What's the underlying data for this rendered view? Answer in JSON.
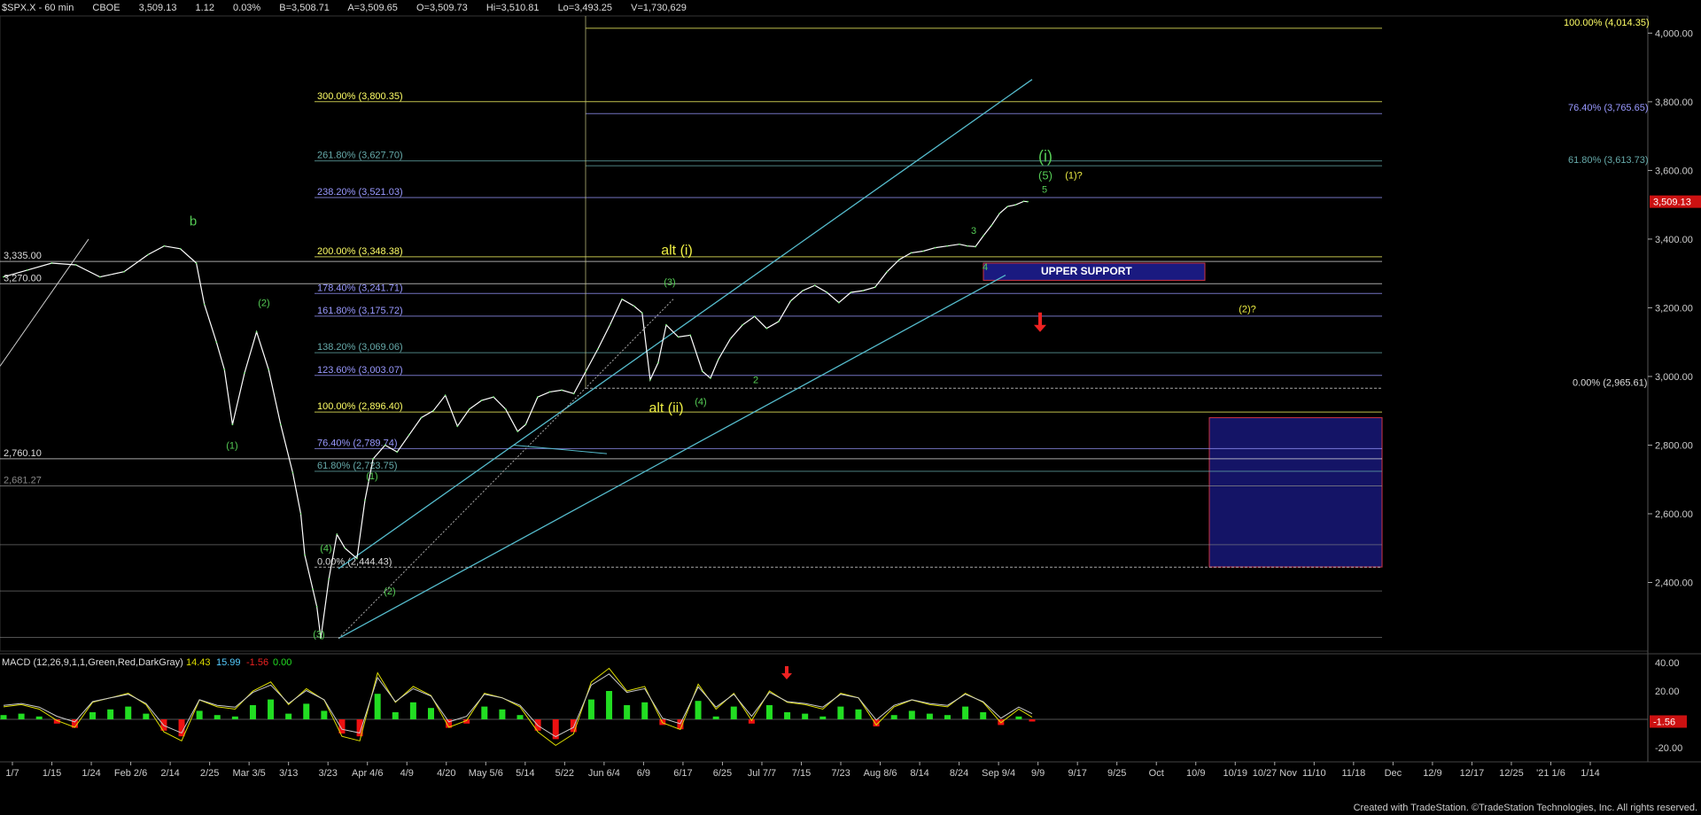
{
  "header": {
    "symbol": "$SPX.X - 60 min",
    "exchange": "CBOE",
    "last": "3,509.13",
    "change": "1.12",
    "change_pct": "0.03%",
    "bid": "B=3,508.71",
    "ask": "A=3,509.65",
    "open": "O=3,509.73",
    "high": "Hi=3,510.81",
    "low": "Lo=3,493.25",
    "volume": "V=1,730,629"
  },
  "macd_label": {
    "params": "MACD (12,26,9,1,1,Green,Red,DarkGray)",
    "v1": "14.43",
    "v2": "15.99",
    "v3": "-1.56",
    "v4": "0.00"
  },
  "credit": "Created with TradeStation. ©TradeStation Technologies, Inc. All rights reserved.",
  "colors": {
    "background": "#000000",
    "price": "#ffffff",
    "fib_yellow": "#ffff66",
    "fib_blue": "#9999ff",
    "fib_teal": "#66aaaa",
    "wave_green": "#55cc55",
    "alt_yellow": "#eeee44",
    "channel": "#55bbcc",
    "box_fill": "#141466",
    "box_border": "#cc3344",
    "macd_pos": "#22dd22",
    "macd_neg": "#ee1111",
    "price_tag": "#cc1111"
  },
  "chart_data": {
    "type": "line",
    "title": "$SPX.X - 60 min",
    "ylim": [
      2200,
      4050
    ],
    "y_ticks": [
      "4,000.00",
      "3,800.00",
      "3,600.00",
      "3,400.00",
      "3,200.00",
      "3,000.00",
      "2,800.00",
      "2,600.00",
      "2,400.00"
    ],
    "y_tick_values": [
      4000,
      3800,
      3600,
      3400,
      3200,
      3000,
      2800,
      2600,
      2400
    ],
    "x_ticks": [
      "1/7",
      "1/15",
      "1/24",
      "Feb 2/6",
      "2/14",
      "2/25",
      "Mar 3/5",
      "3/13",
      "3/23",
      "Apr 4/6",
      "4/9",
      "4/20",
      "May 5/6",
      "5/14",
      "5/22",
      "Jun 6/4",
      "6/9",
      "6/17",
      "6/25",
      "Jul 7/7",
      "7/15",
      "7/23",
      "Aug 8/6",
      "8/14",
      "8/24",
      "Sep 9/4",
      "9/9",
      "9/17",
      "9/25",
      "Oct",
      "10/9",
      "10/19",
      "10/27 Nov",
      "11/10",
      "11/18",
      "Dec",
      "12/9",
      "12/17",
      "12/25",
      "'21 1/6",
      "1/14"
    ],
    "last_price": "3,509.13",
    "last_price_value": 3509.13,
    "price_path": [
      [
        0,
        3290
      ],
      [
        6,
        3310
      ],
      [
        12,
        3330
      ],
      [
        18,
        3325
      ],
      [
        24,
        3290
      ],
      [
        30,
        3305
      ],
      [
        36,
        3355
      ],
      [
        40,
        3380
      ],
      [
        44,
        3372
      ],
      [
        48,
        3330
      ],
      [
        50,
        3210
      ],
      [
        53,
        3100
      ],
      [
        55,
        3020
      ],
      [
        57,
        2860
      ],
      [
        60,
        3010
      ],
      [
        63,
        3130
      ],
      [
        66,
        3020
      ],
      [
        69,
        2860
      ],
      [
        72,
        2720
      ],
      [
        74,
        2600
      ],
      [
        75,
        2480
      ],
      [
        77,
        2380
      ],
      [
        78,
        2330
      ],
      [
        79,
        2237
      ],
      [
        81,
        2410
      ],
      [
        83,
        2540
      ],
      [
        85,
        2500
      ],
      [
        88,
        2470
      ],
      [
        90,
        2640
      ],
      [
        92,
        2760
      ],
      [
        95,
        2800
      ],
      [
        98,
        2780
      ],
      [
        101,
        2830
      ],
      [
        104,
        2880
      ],
      [
        107,
        2900
      ],
      [
        110,
        2945
      ],
      [
        113,
        2855
      ],
      [
        116,
        2905
      ],
      [
        119,
        2930
      ],
      [
        122,
        2940
      ],
      [
        125,
        2905
      ],
      [
        128,
        2840
      ],
      [
        130,
        2860
      ],
      [
        133,
        2940
      ],
      [
        136,
        2955
      ],
      [
        139,
        2960
      ],
      [
        142,
        2950
      ],
      [
        145,
        3015
      ],
      [
        148,
        3080
      ],
      [
        151,
        3150
      ],
      [
        154,
        3225
      ],
      [
        157,
        3205
      ],
      [
        159,
        3185
      ],
      [
        161,
        2990
      ],
      [
        163,
        3040
      ],
      [
        165,
        3150
      ],
      [
        168,
        3115
      ],
      [
        171,
        3120
      ],
      [
        174,
        3015
      ],
      [
        176,
        2995
      ],
      [
        178,
        3050
      ],
      [
        181,
        3110
      ],
      [
        184,
        3150
      ],
      [
        187,
        3175
      ],
      [
        190,
        3140
      ],
      [
        193,
        3160
      ],
      [
        196,
        3220
      ],
      [
        199,
        3250
      ],
      [
        202,
        3265
      ],
      [
        205,
        3245
      ],
      [
        208,
        3215
      ],
      [
        211,
        3245
      ],
      [
        214,
        3250
      ],
      [
        217,
        3260
      ],
      [
        220,
        3305
      ],
      [
        223,
        3340
      ],
      [
        226,
        3360
      ],
      [
        229,
        3365
      ],
      [
        232,
        3375
      ],
      [
        235,
        3380
      ],
      [
        238,
        3385
      ],
      [
        240,
        3380
      ],
      [
        242,
        3378
      ],
      [
        244,
        3410
      ],
      [
        246,
        3440
      ],
      [
        248,
        3475
      ],
      [
        250,
        3495
      ],
      [
        252,
        3500
      ],
      [
        254,
        3510
      ],
      [
        255,
        3509.13
      ]
    ],
    "fib_levels": [
      {
        "label": "100.00% (4,014.35)",
        "value": 4014.35
      },
      {
        "label": "300.00% (3,800.35)",
        "value": 3800.35
      },
      {
        "label": "76.40% (3,765.65)",
        "value": 3765.65
      },
      {
        "label": "261.80% (3,627.70)",
        "value": 3627.7
      },
      {
        "label": "61.80% (3,613.73)",
        "value": 3613.73
      },
      {
        "label": "238.20% (3,521.03)",
        "value": 3521.03
      },
      {
        "label": "200.00% (3,348.38)",
        "value": 3348.38
      },
      {
        "label": "178.40% (3,241.71)",
        "value": 3241.71
      },
      {
        "label": "161.80% (3,175.72)",
        "value": 3175.72
      },
      {
        "label": "138.20% (3,069.06)",
        "value": 3069.06
      },
      {
        "label": "123.60% (3,003.07)",
        "value": 3003.07
      },
      {
        "label": "0.00% (2,965.61)",
        "value": 2965.61
      },
      {
        "label": "100.00% (2,896.40)",
        "value": 2896.4
      },
      {
        "label": "76.40% (2,789.74)",
        "value": 2789.74
      },
      {
        "label": "61.80% (2,723.75)",
        "value": 2723.75
      },
      {
        "label": "0.00% (2,444.43)",
        "value": 2444.43
      },
      {
        "label": "3,335.00",
        "value": 3335.0
      },
      {
        "label": "3,270.00",
        "value": 3270.0
      },
      {
        "label": "2,760.10",
        "value": 2760.1
      },
      {
        "label": "2,681.27",
        "value": 2681.27
      }
    ],
    "wave_labels": [
      {
        "text": "b"
      },
      {
        "text": "(2)"
      },
      {
        "text": "(1)"
      },
      {
        "text": "(1)"
      },
      {
        "text": "(4)"
      },
      {
        "text": "(2)"
      },
      {
        "text": "(3)"
      },
      {
        "text": "alt (i)"
      },
      {
        "text": "alt (ii)"
      },
      {
        "text": "(3)"
      },
      {
        "text": "(4)"
      },
      {
        "text": "2"
      },
      {
        "text": "3"
      },
      {
        "text": "4"
      },
      {
        "text": "5"
      },
      {
        "text": "(5)"
      },
      {
        "text": "(i)"
      },
      {
        "text": "(1)?"
      },
      {
        "text": "(2)?"
      }
    ],
    "annotations": [
      "UPPER SUPPORT"
    ],
    "macd": {
      "params": "MACD (12,26,9,1,1,Green,Red,DarkGray)",
      "ylim": [
        -30,
        45
      ],
      "ticks": [
        "40.00",
        "20.00",
        "-1.56",
        "-20.00"
      ],
      "tick_values": [
        40,
        20,
        -1.56,
        -20
      ],
      "histogram": [
        [
          0,
          3
        ],
        [
          8,
          4
        ],
        [
          16,
          2
        ],
        [
          24,
          -3
        ],
        [
          32,
          -6
        ],
        [
          40,
          5
        ],
        [
          48,
          7
        ],
        [
          56,
          9
        ],
        [
          64,
          4
        ],
        [
          72,
          -8
        ],
        [
          80,
          -12
        ],
        [
          88,
          6
        ],
        [
          96,
          3
        ],
        [
          104,
          2
        ],
        [
          112,
          10
        ],
        [
          120,
          14
        ],
        [
          128,
          4
        ],
        [
          136,
          11
        ],
        [
          144,
          6
        ],
        [
          152,
          -10
        ],
        [
          160,
          -12
        ],
        [
          168,
          18
        ],
        [
          176,
          5
        ],
        [
          184,
          12
        ],
        [
          192,
          8
        ],
        [
          200,
          -6
        ],
        [
          208,
          -3
        ],
        [
          216,
          9
        ],
        [
          224,
          7
        ],
        [
          232,
          3
        ],
        [
          240,
          -8
        ],
        [
          248,
          -14
        ],
        [
          256,
          -9
        ],
        [
          264,
          14
        ],
        [
          272,
          20
        ],
        [
          280,
          10
        ],
        [
          288,
          12
        ],
        [
          296,
          -4
        ],
        [
          304,
          -7
        ],
        [
          312,
          13
        ],
        [
          320,
          2
        ],
        [
          328,
          9
        ],
        [
          336,
          -3
        ],
        [
          344,
          10
        ],
        [
          352,
          5
        ],
        [
          360,
          4
        ],
        [
          368,
          2
        ],
        [
          376,
          9
        ],
        [
          384,
          7
        ],
        [
          392,
          -5
        ],
        [
          400,
          3
        ],
        [
          408,
          6
        ],
        [
          416,
          4
        ],
        [
          424,
          3
        ],
        [
          432,
          9
        ],
        [
          440,
          5
        ],
        [
          448,
          -4
        ],
        [
          456,
          2
        ],
        [
          462,
          -1.56
        ]
      ]
    }
  }
}
